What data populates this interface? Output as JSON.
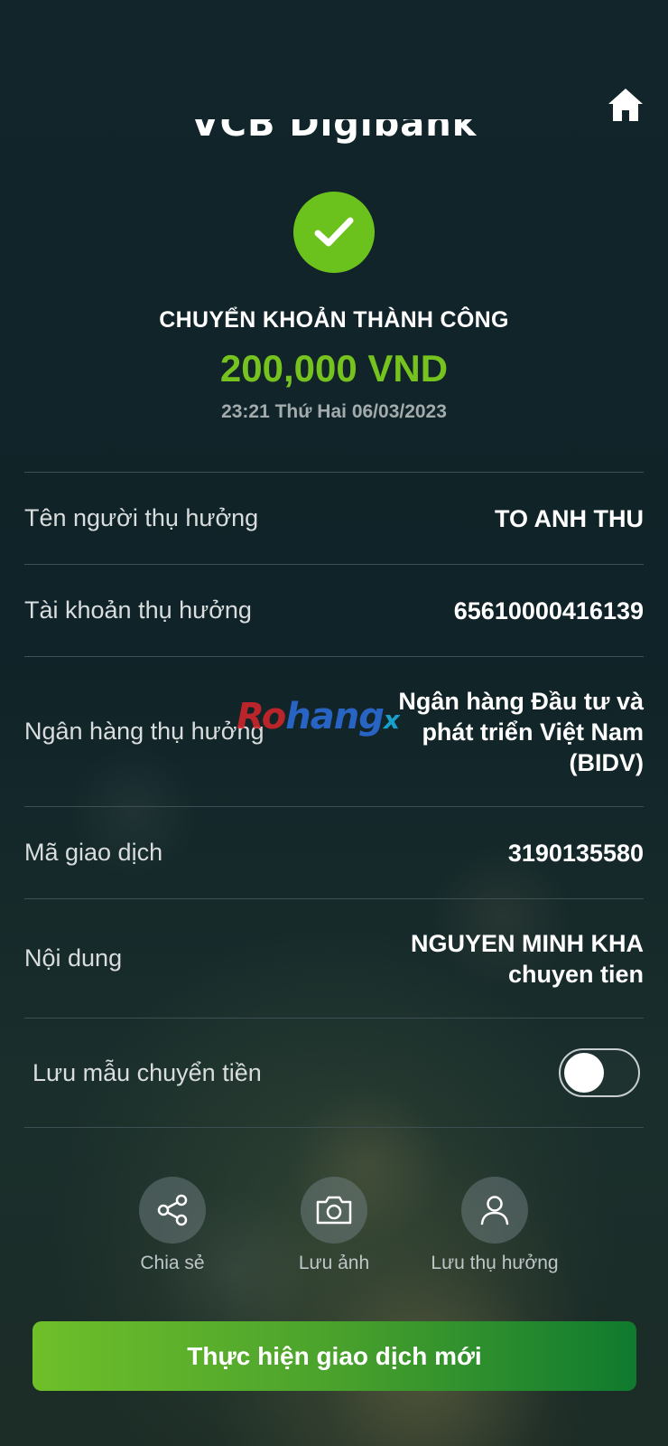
{
  "header": {
    "logo_text": "VCB Digibank",
    "home_icon": "home-icon"
  },
  "status": {
    "icon": "check-icon",
    "title": "CHUYỂN KHOẢN THÀNH CÔNG",
    "amount": "200,000 VND",
    "datetime": "23:21 Thứ Hai 06/03/2023",
    "accent_color": "#76c21f"
  },
  "details": [
    {
      "label": "Tên người thụ hưởng",
      "value": "TO ANH THU"
    },
    {
      "label": "Tài khoản thụ hưởng",
      "value": "65610000416139"
    },
    {
      "label": "Ngân hàng thụ hưởng",
      "value": "Ngân hàng  Đầu tư và phát triển Việt Nam (BIDV)"
    },
    {
      "label": "Mã giao dịch",
      "value": "3190135580"
    },
    {
      "label": "Nội dung",
      "value": "NGUYEN MINH KHA chuyen tien"
    }
  ],
  "save_template": {
    "label": "Lưu mẫu chuyển tiền",
    "enabled": false
  },
  "actions": [
    {
      "label": "Chia sẻ",
      "icon": "share-icon"
    },
    {
      "label": "Lưu ảnh",
      "icon": "camera-icon"
    },
    {
      "label": "Lưu thụ hưởng",
      "icon": "user-icon"
    }
  ],
  "cta": {
    "label": "Thực hiện giao dịch mới"
  },
  "watermark": {
    "part1": "Ro",
    "part2": "hang",
    "part3": "x"
  }
}
